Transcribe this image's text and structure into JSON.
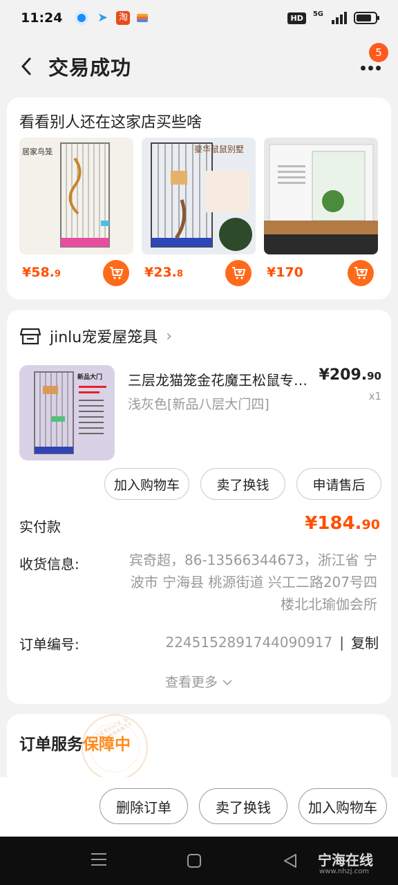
{
  "status_bar": {
    "time": "11:24",
    "hd": "HD",
    "network": "5G"
  },
  "header": {
    "title": "交易成功",
    "more_badge": "5"
  },
  "recommend": {
    "title": "看看别人还在这家店买些啥",
    "items": [
      {
        "price_int": "¥58.",
        "price_dec": "9",
        "img_label": "居家鸟笼"
      },
      {
        "price_int": "¥23.",
        "price_dec": "8",
        "img_label": "豪华鼠鼠别墅"
      },
      {
        "price_int": "¥170",
        "price_dec": "",
        "img_label": ""
      }
    ]
  },
  "order": {
    "shop_name": "jinlu宠爱屋笼具",
    "product": {
      "title": "三层龙猫笼金花魔王松鼠专用笼",
      "variant": "浅灰色[新品八层大门四]",
      "price_int": "¥209.",
      "price_dec": "90",
      "qty": "x1",
      "img_label": "新品大门"
    },
    "actions": [
      "加入购物车",
      "卖了换钱",
      "申请售后"
    ],
    "paid_label": "实付款",
    "paid_int": "¥184.",
    "paid_dec": "90",
    "address_label": "收货信息:",
    "address": "宾奇超，86-13566344673，浙江省 宁波市 宁海县 桃源街道 兴工二路207号四楼北北瑜伽会所",
    "order_no_label": "订单编号:",
    "order_no": "2245152891744090917",
    "copy": "复制",
    "see_more": "查看更多"
  },
  "service": {
    "title_prefix": "订单服务",
    "title_hl": "保障中",
    "stamp_text": "SERVICE & WARRANTY"
  },
  "bottom_bar": {
    "delete": "删除订单",
    "sell": "卖了换钱",
    "add_cart": "加入购物车"
  },
  "watermark": {
    "text": "宁海在线",
    "url": "www.nhzj.com"
  },
  "colors": {
    "accent": "#ff5000",
    "cart_button": "#ff6a1a",
    "guarantee": "#ff8a1e"
  }
}
